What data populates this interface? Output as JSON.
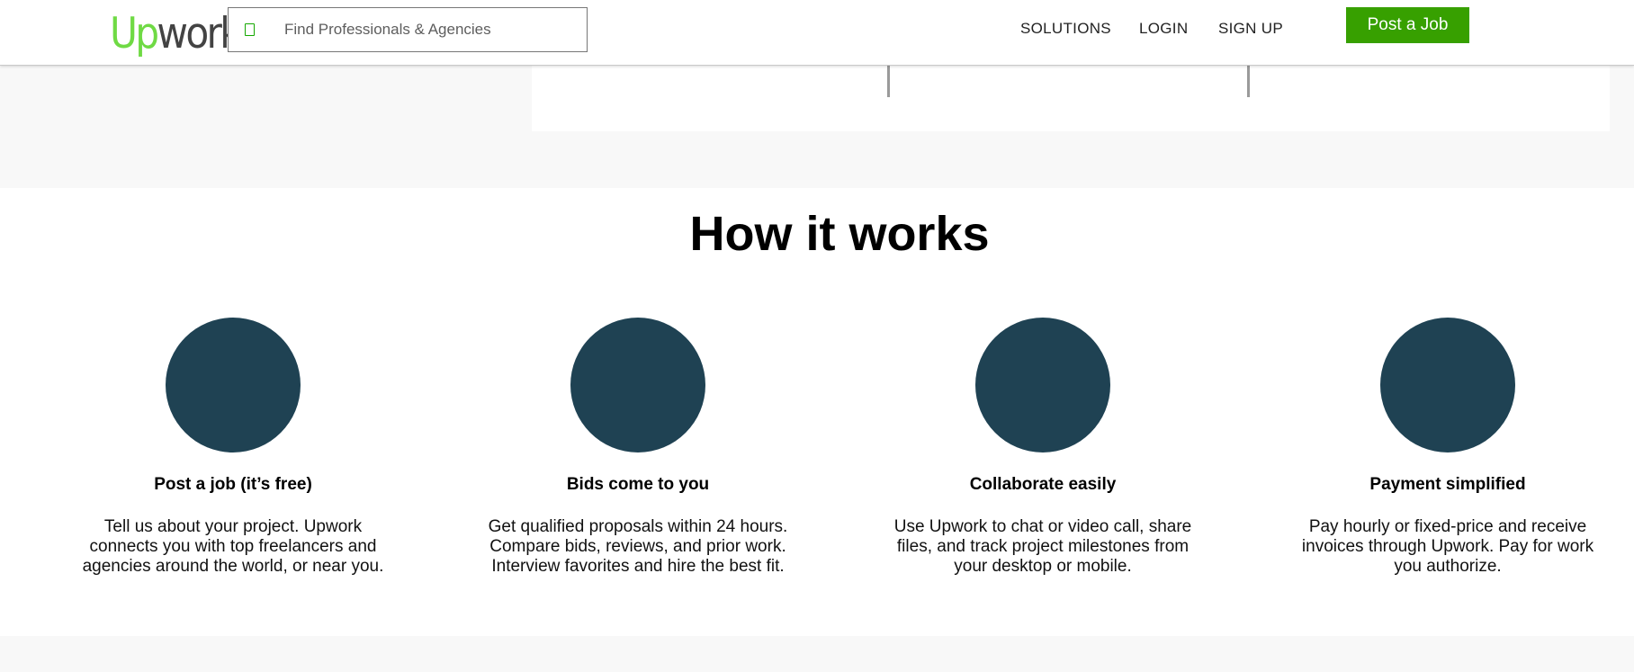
{
  "header": {
    "logo_up": "Up",
    "logo_work": "work",
    "search_placeholder": "Find Professionals & Agencies",
    "nav": {
      "solutions": "SOLUTIONS",
      "login": "LOGIN",
      "signup": "SIGN UP"
    },
    "post_job": "Post a Job"
  },
  "how_it_works": {
    "title": "How it works",
    "steps": [
      {
        "title": "Post a job (it’s free)",
        "text": "Tell us about your project. Upwork connects you with top freelancers and agencies around the world, or near you."
      },
      {
        "title": "Bids come to you",
        "text": "Get qualified proposals within 24 hours. Compare bids, reviews, and prior work. Interview favorites and hire the best fit."
      },
      {
        "title": "Collaborate easily",
        "text": "Use Upwork to chat or video call, share files, and track project milestones from your desktop or mobile."
      },
      {
        "title": "Payment simplified",
        "text": "Pay hourly or fixed-price and receive invoices through Upwork. Pay for work you authorize."
      }
    ]
  },
  "colors": {
    "brand_green": "#37a000",
    "logo_green": "#6fda44",
    "circle": "#1f4253"
  }
}
